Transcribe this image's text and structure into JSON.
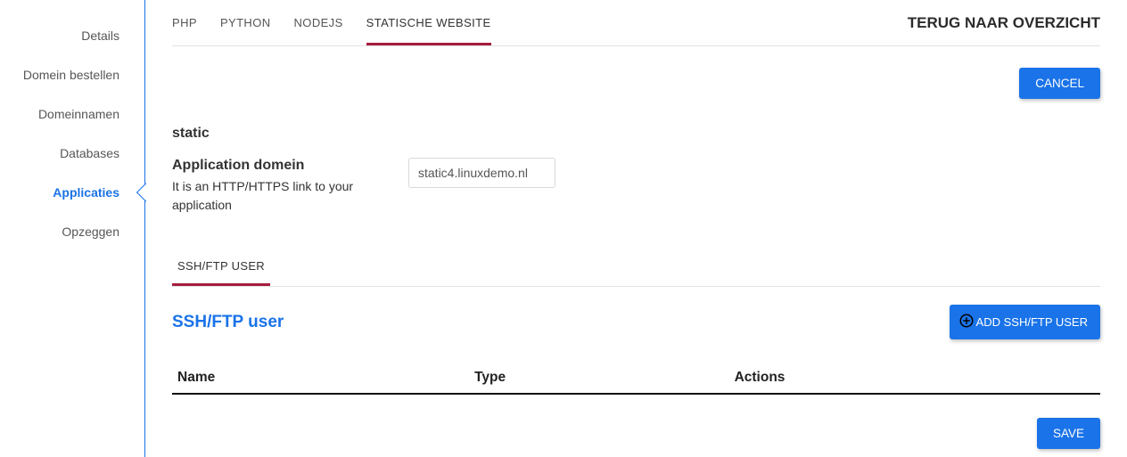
{
  "sidebar": {
    "items": [
      {
        "label": "Details"
      },
      {
        "label": "Domein bestellen"
      },
      {
        "label": "Domeinnamen"
      },
      {
        "label": "Databases"
      },
      {
        "label": "Applicaties"
      },
      {
        "label": "Opzeggen"
      }
    ]
  },
  "topbar": {
    "tabs": [
      {
        "label": "PHP"
      },
      {
        "label": "PYTHON"
      },
      {
        "label": "NODEJS"
      },
      {
        "label": "STATISCHE WEBSITE"
      }
    ],
    "back_label": "TERUG NAAR OVERZICHT"
  },
  "buttons": {
    "cancel": "CANCEL",
    "save": "SAVE",
    "add_user": "ADD SSH/FTP USER"
  },
  "app": {
    "title": "static",
    "domain_label": "Application domein",
    "domain_sub": "It is an HTTP/HTTPS link to your application",
    "domain_value": "static4.linuxdemo.nl"
  },
  "subtabs": {
    "items": [
      {
        "label": "SSH/FTP USER"
      }
    ]
  },
  "section": {
    "heading": "SSH/FTP user"
  },
  "table": {
    "columns": {
      "name": "Name",
      "type": "Type",
      "actions": "Actions"
    }
  }
}
